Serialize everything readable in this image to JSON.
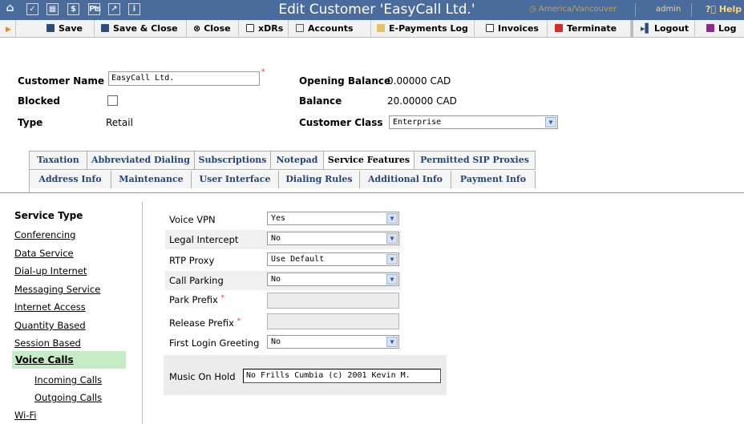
{
  "header": {
    "title": "Edit Customer 'EasyCall Ltd.'",
    "timezone": "America/Vancouver",
    "user": "admin",
    "help": "Help",
    "icons": [
      "home-icon",
      "checklist-icon",
      "grid-icon",
      "dollar-icon",
      "tariff-icon",
      "chart-icon",
      "info-icon"
    ]
  },
  "toolbar": {
    "save": "Save",
    "save_close": "Save & Close",
    "close": "Close",
    "xdrs": "xDRs",
    "accounts": "Accounts",
    "epayments": "E-Payments Log",
    "invoices": "Invoices",
    "terminate": "Terminate",
    "logout": "Logout",
    "log": "Log"
  },
  "customer": {
    "name_label": "Customer Name",
    "name_value": "EasyCall Ltd.",
    "blocked_label": "Blocked",
    "type_label": "Type",
    "type_value": "Retail",
    "opening_balance_label": "Opening Balance",
    "opening_balance_value": "0.00000 CAD",
    "balance_label": "Balance",
    "balance_value": "20.00000 CAD",
    "class_label": "Customer Class",
    "class_value": "Enterprise"
  },
  "tabs": {
    "row1": [
      "Taxation",
      "Abbreviated Dialing",
      "Subscriptions",
      "Notepad",
      "Service Features",
      "Permitted SIP Proxies"
    ],
    "row2": [
      "Address Info",
      "Maintenance",
      "User Interface",
      "Dialing Rules",
      "Additional Info",
      "Payment Info"
    ],
    "active": "Service Features"
  },
  "sidebar": {
    "heading": "Service Type",
    "items": [
      "Conferencing",
      "Data Service",
      "Dial-up Internet",
      "Messaging Service",
      "Internet Access",
      "Quantity Based",
      "Session Based"
    ],
    "active": "Voice Calls",
    "sub_items": [
      "Incoming Calls",
      "Outgoing Calls"
    ],
    "last": "Wi-Fi"
  },
  "features": {
    "voice_vpn": {
      "label": "Voice VPN",
      "value": "Yes"
    },
    "legal_intercept": {
      "label": "Legal Intercept",
      "value": "No"
    },
    "rtp_proxy": {
      "label": "RTP Proxy",
      "value": "Use Default"
    },
    "call_parking": {
      "label": "Call Parking",
      "value": "No"
    },
    "park_prefix": {
      "label": "Park Prefix"
    },
    "release_prefix": {
      "label": "Release Prefix"
    },
    "first_login": {
      "label": "First Login Greeting",
      "value": "No"
    },
    "music_on_hold": {
      "label": "Music On Hold",
      "value": "No Frills Cumbia (c) 2001 Kevin M."
    }
  },
  "colors": {
    "header_bg": "#4a6c9c",
    "active_side": "#c6ecc6",
    "tz": "#c8a050"
  }
}
